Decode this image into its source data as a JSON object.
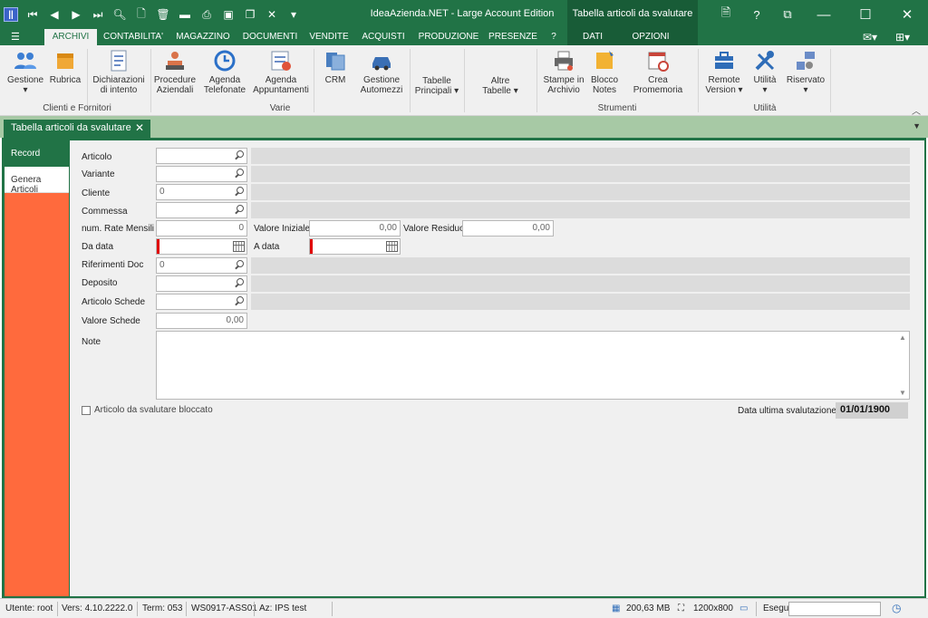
{
  "titlebar": {
    "app_title": "IdeaAzienda.NET - Large Account Edition",
    "context_title": "Tabella articoli da svalutare",
    "help_label": "?"
  },
  "ribbon_tabs": {
    "menu_label": "☰",
    "tabs": [
      "ARCHIVI",
      "CONTABILITA'",
      "MAGAZZINO",
      "DOCUMENTI",
      "VENDITE",
      "ACQUISTI",
      "PRODUZIONE",
      "PRESENZE",
      "?"
    ],
    "context_tabs": [
      "DATI",
      "OPZIONI"
    ]
  },
  "ribbon": {
    "buttons": {
      "gestione": "Gestione",
      "rubrica": "Rubrica",
      "dichiarazioni_1": "Dichiarazioni",
      "dichiarazioni_2": "di intento",
      "procedure_1": "Procedure",
      "procedure_2": "Aziendali",
      "agenda_tel_1": "Agenda",
      "agenda_tel_2": "Telefonate",
      "agenda_app_1": "Agenda",
      "agenda_app_2": "Appuntamenti",
      "crm": "CRM",
      "automezzi_1": "Gestione",
      "automezzi_2": "Automezzi",
      "tabelle_1": "Tabelle",
      "tabelle_2": "Principali",
      "altre_1": "Altre",
      "altre_2": "Tabelle",
      "stampe_1": "Stampe in",
      "stampe_2": "Archivio",
      "blocco_1": "Blocco",
      "blocco_2": "Notes",
      "promemoria": "Crea Promemoria",
      "remote_1": "Remote",
      "remote_2": "Version",
      "utilita": "Utilità",
      "riservato": "Riservato"
    },
    "groups": {
      "clienti_fornitori": "Clienti e Fornitori",
      "varie": "Varie",
      "strumenti": "Strumenti",
      "utilita": "Utilità"
    }
  },
  "doc_tab": {
    "title": "Tabella articoli da svalutare"
  },
  "side_panel": {
    "items": [
      "Record",
      "Genera Articoli"
    ]
  },
  "form": {
    "articolo": "Articolo",
    "variante": "Variante",
    "cliente": "Cliente",
    "cliente_value": "0",
    "commessa": "Commessa",
    "num_rate": "num. Rate Mensili",
    "num_rate_value": "0",
    "valore_iniziale": "Valore Iniziale",
    "valore_iniziale_value": "0,00",
    "valore_residuo": "Valore Residuo",
    "valore_residuo_value": "0,00",
    "da_data": "Da data",
    "a_data": "A data",
    "riferimenti_doc": "Riferimenti Doc",
    "riferimenti_doc_value": "0",
    "deposito": "Deposito",
    "articolo_schede": "Articolo Schede",
    "valore_schede": "Valore Schede",
    "valore_schede_value": "0,00",
    "note": "Note",
    "bloccato": "Articolo da svalutare bloccato",
    "data_ultima_label": "Data ultima svalutazione",
    "data_ultima_value": "01/01/1900"
  },
  "statusbar": {
    "utente": "Utente: root",
    "versione": "Vers: 4.10.2222.0",
    "terminale": "Term: 053",
    "workstation": "WS0917-ASS01",
    "azienda": "Az: IPS test",
    "memoria": "200,63 MB",
    "risoluzione": "1200x800",
    "esegui": "Esegui"
  }
}
